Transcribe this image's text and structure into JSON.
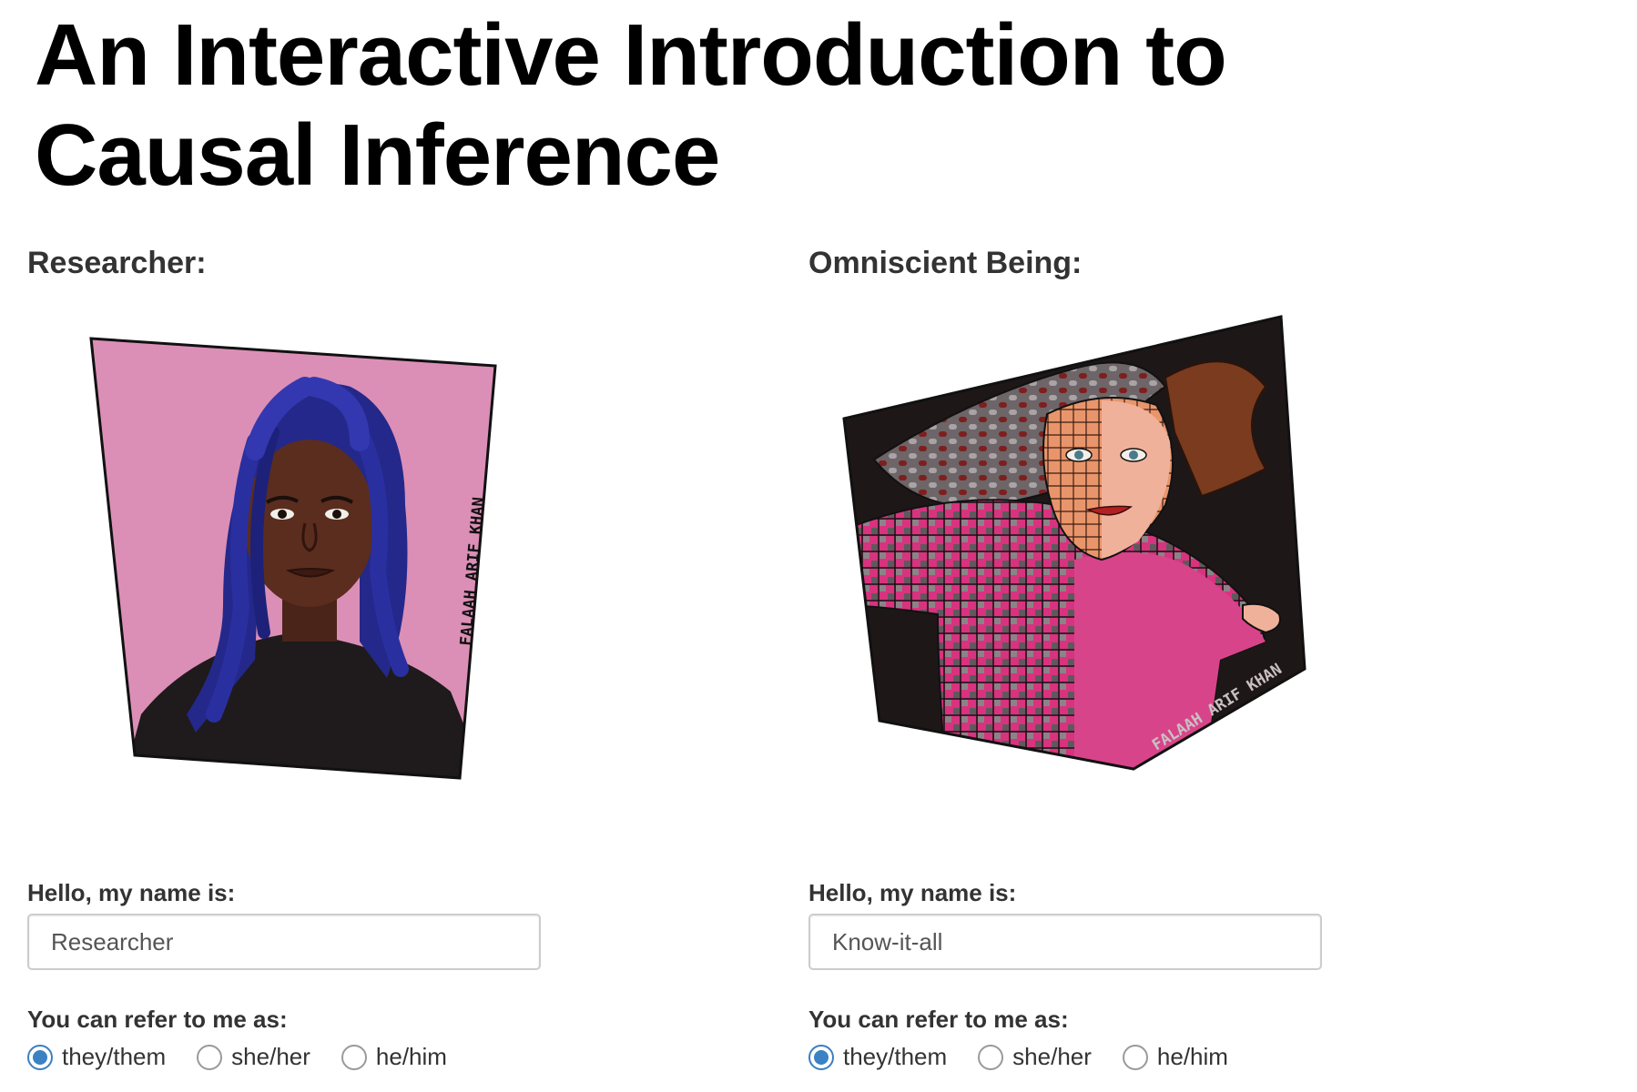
{
  "page": {
    "title": "An Interactive Introduction to Causal Inference"
  },
  "researcher": {
    "role_label": "Researcher:",
    "artist_signature": "FALAAH ARIF KHAN",
    "name_label": "Hello, my name is:",
    "name_value": "Researcher",
    "pronoun_label": "You can refer to me as:",
    "pronouns": [
      {
        "label": "they/them",
        "checked": true
      },
      {
        "label": "she/her",
        "checked": false
      },
      {
        "label": "he/him",
        "checked": false
      }
    ]
  },
  "omniscient": {
    "role_label": "Omniscient Being:",
    "artist_signature": "FALAAH ARIF KHAN",
    "name_label": "Hello, my name is:",
    "name_value": "Know-it-all",
    "pronoun_label": "You can refer to me as:",
    "pronouns": [
      {
        "label": "they/them",
        "checked": true
      },
      {
        "label": "she/her",
        "checked": false
      },
      {
        "label": "he/him",
        "checked": false
      }
    ]
  },
  "colors": {
    "accent": "#3b82c4",
    "researcher_bg": "#db8fb6",
    "omniscient_bg": "#1e1718",
    "hair_blue": "#24288a"
  }
}
